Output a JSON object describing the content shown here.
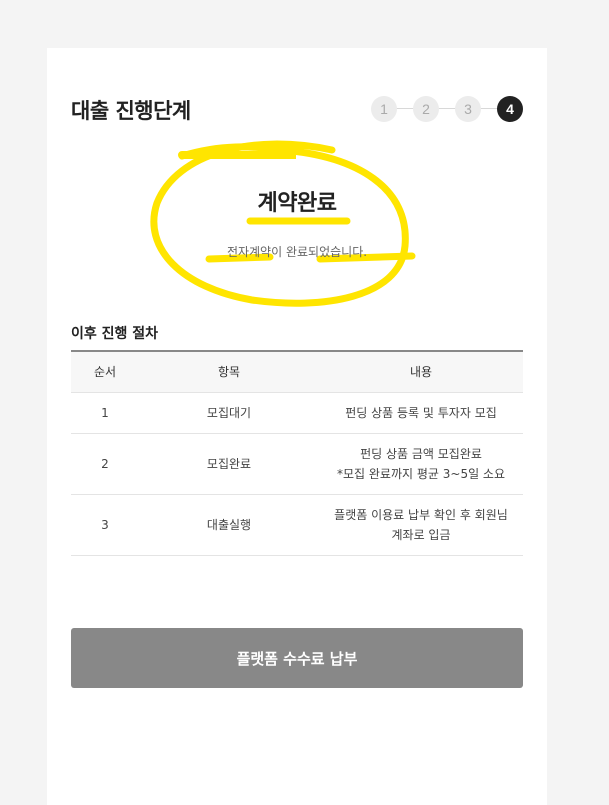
{
  "header": {
    "title": "대출 진행단계"
  },
  "stepper": {
    "steps": [
      "1",
      "2",
      "3",
      "4"
    ],
    "current": 4
  },
  "status": {
    "title": "계약완료",
    "description": "전자계약이 완료되었습니다."
  },
  "highlight_color": "#FFE500",
  "procedure": {
    "title": "이후 진행 절차",
    "headers": [
      "순서",
      "항목",
      "내용"
    ],
    "rows": [
      {
        "order": "1",
        "item": "모집대기",
        "content_line1": "펀딩 상품 등록 및 투자자 모집",
        "content_line2": ""
      },
      {
        "order": "2",
        "item": "모집완료",
        "content_line1": "펀딩 상품 금액 모집완료",
        "content_line2": "*모집 완료까지 평균 3~5일 소요"
      },
      {
        "order": "3",
        "item": "대출실행",
        "content_line1": "플랫폼 이용료 납부 확인 후 회원님",
        "content_line2": "계좌로 입금"
      }
    ]
  },
  "pay_button": {
    "label": "플랫폼 수수료 납부",
    "color": "#888888"
  }
}
